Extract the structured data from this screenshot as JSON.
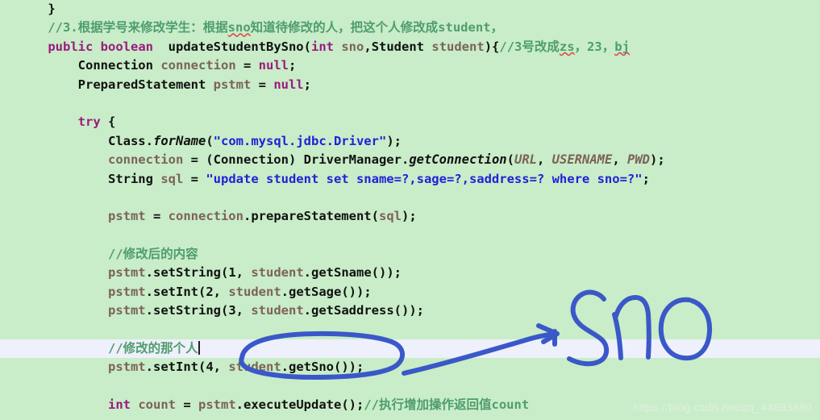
{
  "editor": {
    "background_color": "#c8edc8",
    "highlight_line_color": "#eef0fb",
    "ink_color": "#3a58c8",
    "indent": "    ",
    "lines": [
      {
        "id": "line-close-brace",
        "indent": 1,
        "highlight": false,
        "tokens": [
          {
            "t": "}",
            "c": "plain"
          }
        ]
      },
      {
        "id": "line-comment-3",
        "indent": 1,
        "highlight": false,
        "tokens": [
          {
            "t": "//3.根据学号来修改学生：根据",
            "c": "cmt"
          },
          {
            "t": "sno",
            "c": "cmt sq"
          },
          {
            "t": "知道待修改的人，把这个人修改成student，",
            "c": "cmt"
          }
        ]
      },
      {
        "id": "line-method-signature",
        "indent": 1,
        "highlight": false,
        "tokens": [
          {
            "t": "public",
            "c": "kw"
          },
          {
            "t": " ",
            "c": "plain"
          },
          {
            "t": "boolean",
            "c": "kw"
          },
          {
            "t": "  ",
            "c": "plain"
          },
          {
            "t": "updateStudentBySno",
            "c": "mth"
          },
          {
            "t": "(",
            "c": "plain"
          },
          {
            "t": "int",
            "c": "kw"
          },
          {
            "t": " ",
            "c": "plain"
          },
          {
            "t": "sno",
            "c": "var"
          },
          {
            "t": ",",
            "c": "plain"
          },
          {
            "t": "Student",
            "c": "typ"
          },
          {
            "t": " ",
            "c": "plain"
          },
          {
            "t": "student",
            "c": "var"
          },
          {
            "t": "){",
            "c": "plain"
          },
          {
            "t": "//3号改成",
            "c": "cmt"
          },
          {
            "t": "zs",
            "c": "cmt sq"
          },
          {
            "t": "，23，",
            "c": "cmt"
          },
          {
            "t": "bj",
            "c": "cmt sq"
          }
        ]
      },
      {
        "id": "line-connection-decl",
        "indent": 2,
        "highlight": false,
        "tokens": [
          {
            "t": "Connection",
            "c": "typ"
          },
          {
            "t": " ",
            "c": "plain"
          },
          {
            "t": "connection",
            "c": "var"
          },
          {
            "t": " = ",
            "c": "plain"
          },
          {
            "t": "null",
            "c": "kw"
          },
          {
            "t": ";",
            "c": "plain"
          }
        ]
      },
      {
        "id": "line-pstmt-decl",
        "indent": 2,
        "highlight": false,
        "tokens": [
          {
            "t": "PreparedStatement",
            "c": "typ"
          },
          {
            "t": " ",
            "c": "plain"
          },
          {
            "t": "pstmt",
            "c": "var"
          },
          {
            "t": " = ",
            "c": "plain"
          },
          {
            "t": "null",
            "c": "kw"
          },
          {
            "t": ";",
            "c": "plain"
          }
        ]
      },
      {
        "id": "line-blank-1",
        "indent": 0,
        "highlight": false,
        "tokens": []
      },
      {
        "id": "line-try",
        "indent": 2,
        "highlight": false,
        "tokens": [
          {
            "t": "try",
            "c": "kw"
          },
          {
            "t": " {",
            "c": "plain"
          }
        ]
      },
      {
        "id": "line-forname",
        "indent": 3,
        "highlight": false,
        "tokens": [
          {
            "t": "Class",
            "c": "typ"
          },
          {
            "t": ".",
            "c": "plain"
          },
          {
            "t": "forName",
            "c": "mthi"
          },
          {
            "t": "(",
            "c": "plain"
          },
          {
            "t": "\"com.mysql.jdbc.Driver\"",
            "c": "str"
          },
          {
            "t": ");",
            "c": "plain"
          }
        ]
      },
      {
        "id": "line-getconnection",
        "indent": 3,
        "highlight": false,
        "tokens": [
          {
            "t": "connection",
            "c": "var"
          },
          {
            "t": " = (",
            "c": "plain"
          },
          {
            "t": "Connection",
            "c": "typ"
          },
          {
            "t": ") ",
            "c": "plain"
          },
          {
            "t": "DriverManager",
            "c": "typ"
          },
          {
            "t": ".",
            "c": "plain"
          },
          {
            "t": "getConnection",
            "c": "mthi"
          },
          {
            "t": "(",
            "c": "plain"
          },
          {
            "t": "URL",
            "c": "fld"
          },
          {
            "t": ", ",
            "c": "plain"
          },
          {
            "t": "USERNAME",
            "c": "fld"
          },
          {
            "t": ", ",
            "c": "plain"
          },
          {
            "t": "PWD",
            "c": "fld"
          },
          {
            "t": ");",
            "c": "plain"
          }
        ]
      },
      {
        "id": "line-sql-string",
        "indent": 3,
        "highlight": false,
        "tokens": [
          {
            "t": "String",
            "c": "typ"
          },
          {
            "t": " ",
            "c": "plain"
          },
          {
            "t": "sql",
            "c": "var"
          },
          {
            "t": " = ",
            "c": "plain"
          },
          {
            "t": "\"update student set sname=?,sage=?,saddress=? where sno=?\"",
            "c": "str"
          },
          {
            "t": ";",
            "c": "plain"
          }
        ]
      },
      {
        "id": "line-blank-2",
        "indent": 0,
        "highlight": false,
        "tokens": []
      },
      {
        "id": "line-preparestatement",
        "indent": 3,
        "highlight": false,
        "tokens": [
          {
            "t": "pstmt",
            "c": "var"
          },
          {
            "t": " = ",
            "c": "plain"
          },
          {
            "t": "connection",
            "c": "var"
          },
          {
            "t": ".",
            "c": "plain"
          },
          {
            "t": "prepareStatement",
            "c": "mth"
          },
          {
            "t": "(",
            "c": "plain"
          },
          {
            "t": "sql",
            "c": "var"
          },
          {
            "t": ");",
            "c": "plain"
          }
        ]
      },
      {
        "id": "line-blank-3",
        "indent": 0,
        "highlight": false,
        "tokens": []
      },
      {
        "id": "line-comment-after-edit",
        "indent": 3,
        "highlight": false,
        "tokens": [
          {
            "t": "//修改后的内容",
            "c": "cmt"
          }
        ]
      },
      {
        "id": "line-setstring-1",
        "indent": 3,
        "highlight": false,
        "tokens": [
          {
            "t": "pstmt",
            "c": "var"
          },
          {
            "t": ".",
            "c": "plain"
          },
          {
            "t": "setString",
            "c": "mth"
          },
          {
            "t": "(1, ",
            "c": "plain"
          },
          {
            "t": "student",
            "c": "var"
          },
          {
            "t": ".",
            "c": "plain"
          },
          {
            "t": "getSname",
            "c": "mth"
          },
          {
            "t": "());",
            "c": "plain"
          }
        ]
      },
      {
        "id": "line-setint-2",
        "indent": 3,
        "highlight": false,
        "tokens": [
          {
            "t": "pstmt",
            "c": "var"
          },
          {
            "t": ".",
            "c": "plain"
          },
          {
            "t": "setInt",
            "c": "mth"
          },
          {
            "t": "(2, ",
            "c": "plain"
          },
          {
            "t": "student",
            "c": "var"
          },
          {
            "t": ".",
            "c": "plain"
          },
          {
            "t": "getSage",
            "c": "mth"
          },
          {
            "t": "());",
            "c": "plain"
          }
        ]
      },
      {
        "id": "line-setstring-3",
        "indent": 3,
        "highlight": false,
        "tokens": [
          {
            "t": "pstmt",
            "c": "var"
          },
          {
            "t": ".",
            "c": "plain"
          },
          {
            "t": "setString",
            "c": "mth"
          },
          {
            "t": "(3, ",
            "c": "plain"
          },
          {
            "t": "student",
            "c": "var"
          },
          {
            "t": ".",
            "c": "plain"
          },
          {
            "t": "getSaddress",
            "c": "mth"
          },
          {
            "t": "());",
            "c": "plain"
          }
        ]
      },
      {
        "id": "line-blank-4",
        "indent": 0,
        "highlight": false,
        "tokens": []
      },
      {
        "id": "line-comment-that-person",
        "indent": 3,
        "highlight": true,
        "tokens": [
          {
            "t": "//修改的那个人",
            "c": "cmt"
          }
        ],
        "caret": true
      },
      {
        "id": "line-setint-4",
        "indent": 3,
        "highlight": false,
        "tokens": [
          {
            "t": "pstmt",
            "c": "var"
          },
          {
            "t": ".",
            "c": "plain"
          },
          {
            "t": "setInt",
            "c": "mth"
          },
          {
            "t": "(4, ",
            "c": "plain"
          },
          {
            "t": "student",
            "c": "var"
          },
          {
            "t": ".",
            "c": "plain"
          },
          {
            "t": "getSno",
            "c": "mth"
          },
          {
            "t": "());",
            "c": "plain"
          }
        ]
      },
      {
        "id": "line-blank-5",
        "indent": 0,
        "highlight": false,
        "tokens": []
      },
      {
        "id": "line-executeupdate",
        "indent": 3,
        "highlight": false,
        "tokens": [
          {
            "t": "int",
            "c": "kw"
          },
          {
            "t": " ",
            "c": "plain"
          },
          {
            "t": "count",
            "c": "var"
          },
          {
            "t": " = ",
            "c": "plain"
          },
          {
            "t": "pstmt",
            "c": "var"
          },
          {
            "t": ".",
            "c": "plain"
          },
          {
            "t": "executeUpdate",
            "c": "mth"
          },
          {
            "t": "();",
            "c": "plain"
          },
          {
            "t": "//执行增加操作返回值count",
            "c": "cmt"
          }
        ]
      }
    ]
  },
  "annotations": {
    "handwriting_text": "Sno",
    "ellipse_target": "student.getSno());",
    "arrow_label": "arrow-to-sno"
  },
  "watermark": {
    "text": "https://blog.csdn.net/qq_44893880"
  }
}
